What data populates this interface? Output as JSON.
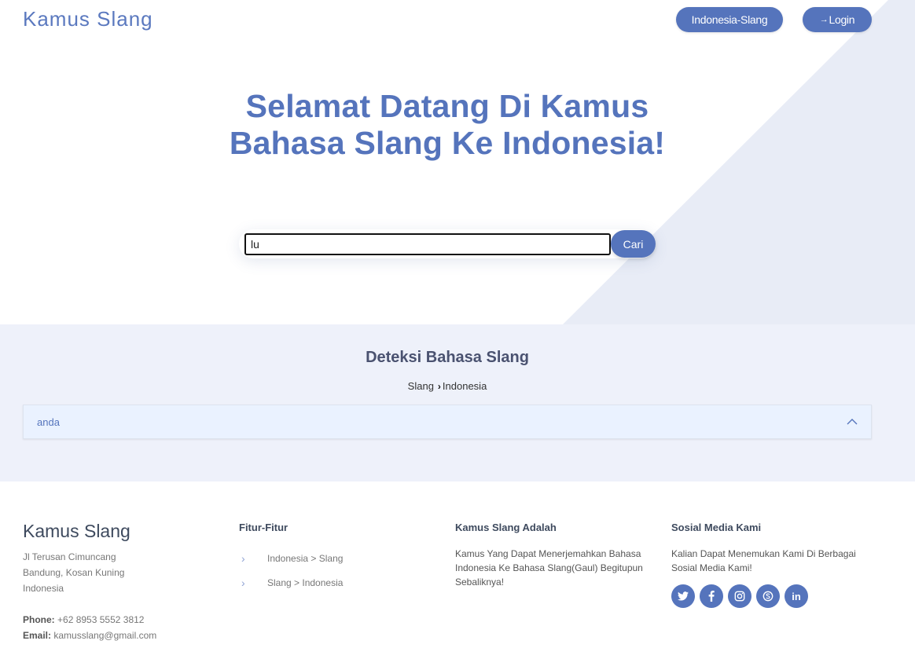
{
  "header": {
    "brand": "Kamus Slang",
    "lang_button": "Indonesia-Slang",
    "login_button": "Login"
  },
  "hero": {
    "title": "Selamat Datang Di Kamus Bahasa Slang Ke Indonesia!"
  },
  "search": {
    "value": "lu",
    "button": "Cari"
  },
  "detect": {
    "title": "Deteksi Bahasa Slang",
    "from": "Slang",
    "to": "Indonesia",
    "result": "anda"
  },
  "footer": {
    "brand": "Kamus Slang",
    "address": [
      "Jl Terusan Cimuncang",
      "Bandung, Kosan Kuning",
      "Indonesia"
    ],
    "phone_label": "Phone:",
    "phone": "+62 8953 5552 3812",
    "email_label": "Email:",
    "email": "kamusslang@gmail.com",
    "features_title": "Fitur-Fitur",
    "features": [
      "Indonesia > Slang",
      "Slang > Indonesia"
    ],
    "about_title": "Kamus Slang Adalah",
    "about_text": "Kamus Yang Dapat Menerjemahkan Bahasa Indonesia Ke Bahasa Slang(Gaul) Begitupun Sebaliknya!",
    "social_title": "Sosial Media Kami",
    "social_text": "Kalian Dapat Menemukan Kami Di Berbagai Sosial Media Kami!",
    "socials": [
      "twitter-icon",
      "facebook-icon",
      "instagram-icon",
      "skype-icon",
      "linkedin-icon"
    ]
  },
  "colors": {
    "accent": "#5574bc",
    "section_bg": "#eef1fa",
    "result_bg": "#eaf2ff"
  }
}
